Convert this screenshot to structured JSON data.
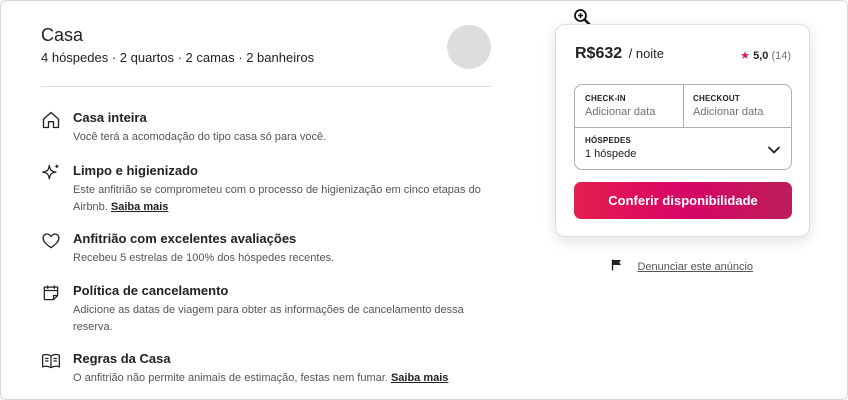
{
  "listing": {
    "title": "Casa",
    "subtitle": "4 hóspedes · 2 quartos · 2 camas · 2 banheiros"
  },
  "features": [
    {
      "icon": "home-icon",
      "title": "Casa inteira",
      "desc": "Você terá a acomodação do tipo casa só para você.",
      "link": ""
    },
    {
      "icon": "sparkle-icon",
      "title": "Limpo e higienizado",
      "desc": "Este anfitrião se comprometeu com o processo de higienização em cinco etapas do Airbnb. ",
      "link": "Saiba mais"
    },
    {
      "icon": "heart-icon",
      "title": "Anfitrião com excelentes avaliações",
      "desc": "Recebeu 5 estrelas de 100% dos hóspedes recentes.",
      "link": ""
    },
    {
      "icon": "calendar-icon",
      "title": "Política de cancelamento",
      "desc": "Adicione as datas de viagem para obter as informações de cancelamento dessa reserva.",
      "link": ""
    },
    {
      "icon": "book-icon",
      "title": "Regras da Casa",
      "desc": "O anfitrião não permite animais de estimação, festas nem fumar. ",
      "link": "Saiba mais"
    }
  ],
  "booking": {
    "price": "R$632",
    "per": "/ noite",
    "star": "★",
    "rating": "5,0",
    "reviews": "(14)",
    "checkin_label": "CHECK-IN",
    "checkin_value": "Adicionar data",
    "checkout_label": "CHECKOUT",
    "checkout_value": "Adicionar data",
    "guests_label": "HÓSPEDES",
    "guests_value": "1 hóspede",
    "cta": "Conferir disponibilidade",
    "accent": "#e61e4d"
  },
  "report": {
    "link": "Denunciar este anúncio"
  }
}
